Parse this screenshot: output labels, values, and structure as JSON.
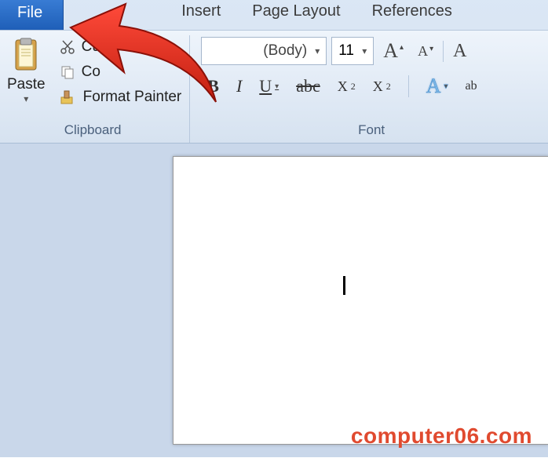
{
  "tabs": {
    "file": "File",
    "insert": "Insert",
    "page_layout": "Page Layout",
    "references": "References"
  },
  "clipboard": {
    "paste": "Paste",
    "cut": "Cu",
    "copy": "Co",
    "format_painter": "Format Painter",
    "group_title": "Clipboard"
  },
  "font": {
    "name_suffix": "(Body)",
    "size": "11",
    "grow": "A",
    "shrink": "A",
    "change_case": "A",
    "bold": "B",
    "italic": "I",
    "underline": "U",
    "strike": "abc",
    "subscript": "X",
    "subscript_sub": "2",
    "superscript": "X",
    "superscript_sup": "2",
    "text_effects": "A",
    "highlight": "ab",
    "group_title": "Font"
  },
  "watermark": "computer06.com"
}
